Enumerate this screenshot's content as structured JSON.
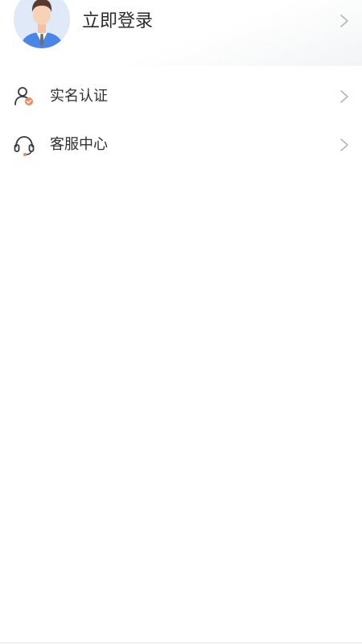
{
  "header": {
    "login_label": "立即登录",
    "avatar_icon": "user-avatar-icon",
    "chevron_icon": "chevron-right-icon"
  },
  "menu": {
    "items": [
      {
        "label": "实名认证",
        "icon": "verified-user-icon"
      },
      {
        "label": "客服中心",
        "icon": "headset-icon"
      }
    ]
  },
  "colors": {
    "accent": "#f0885a",
    "text": "#2f2f2f",
    "chevron": "#b5b5b5",
    "avatar_bg": "#dfe9f7",
    "suit": "#4a86e8"
  }
}
